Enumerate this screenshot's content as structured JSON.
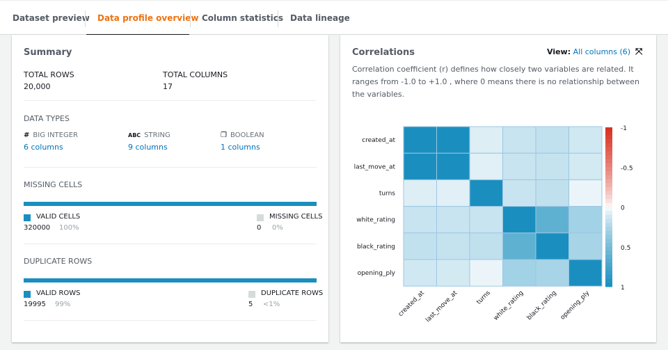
{
  "tabs": [
    {
      "label": "Dataset preview"
    },
    {
      "label": "Data profile overview",
      "active": true
    },
    {
      "label": "Column statistics"
    },
    {
      "label": "Data lineage"
    }
  ],
  "summary": {
    "title": "Summary",
    "total_rows_label": "TOTAL ROWS",
    "total_rows": "20,000",
    "total_columns_label": "TOTAL COLUMNS",
    "total_columns": "17",
    "data_types_label": "DATA TYPES",
    "types": [
      {
        "icon": "hash-icon",
        "glyph": "#",
        "name": "BIG INTEGER",
        "count": "6 columns"
      },
      {
        "icon": "abc-icon",
        "glyph": "ABC",
        "name": "STRING",
        "count": "9 columns"
      },
      {
        "icon": "boolean-icon",
        "glyph": "❐",
        "name": "BOOLEAN",
        "count": "1 columns"
      }
    ],
    "missing": {
      "label": "MISSING CELLS",
      "valid_label": "VALID CELLS",
      "valid_value": "320000",
      "valid_pct": "100%",
      "missing_label": "MISSING CELLS",
      "missing_value": "0",
      "missing_pct": "0%",
      "valid_fraction": 1.0
    },
    "duplicate": {
      "label": "DUPLICATE ROWS",
      "valid_label": "VALID ROWS",
      "valid_value": "19995",
      "valid_pct": "99%",
      "dup_label": "DUPLICATE ROWS",
      "dup_value": "5",
      "dup_pct": "<1%",
      "valid_fraction": 0.99975
    }
  },
  "correlations": {
    "title": "Correlations",
    "view_label": "View:",
    "view_value": "All columns (6)",
    "description": "Correlation coefficient (r) defines how closely two variables are related. It ranges from -1.0 to +1.0 , where 0 means there is no relationship between the variables."
  },
  "colors": {
    "accent": "#ec7211",
    "primary": "#1a8fbf",
    "negative": "#d7301f",
    "link": "#0073bb",
    "missing": "#d5dbdb"
  },
  "chart_data": {
    "type": "heatmap",
    "x": [
      "created_at",
      "last_move_at",
      "turns",
      "white_rating",
      "black_rating",
      "opening_ply"
    ],
    "y": [
      "created_at",
      "last_move_at",
      "turns",
      "white_rating",
      "black_rating",
      "opening_ply"
    ],
    "values": [
      [
        1,
        1,
        0.08,
        0.15,
        0.17,
        0.12
      ],
      [
        1,
        1,
        0.07,
        0.15,
        0.16,
        0.11
      ],
      [
        0.08,
        0.07,
        1,
        0.15,
        0.18,
        0.04
      ],
      [
        0.15,
        0.15,
        0.15,
        1,
        0.62,
        0.3
      ],
      [
        0.17,
        0.16,
        0.18,
        0.62,
        1,
        0.28
      ],
      [
        0.12,
        0.11,
        0.04,
        0.3,
        0.28,
        1
      ]
    ],
    "colorbar": {
      "ticks": [
        "-1",
        "-0.5",
        "0",
        "0.5",
        "1"
      ],
      "range": [
        -1,
        1
      ],
      "reversed": true
    }
  }
}
